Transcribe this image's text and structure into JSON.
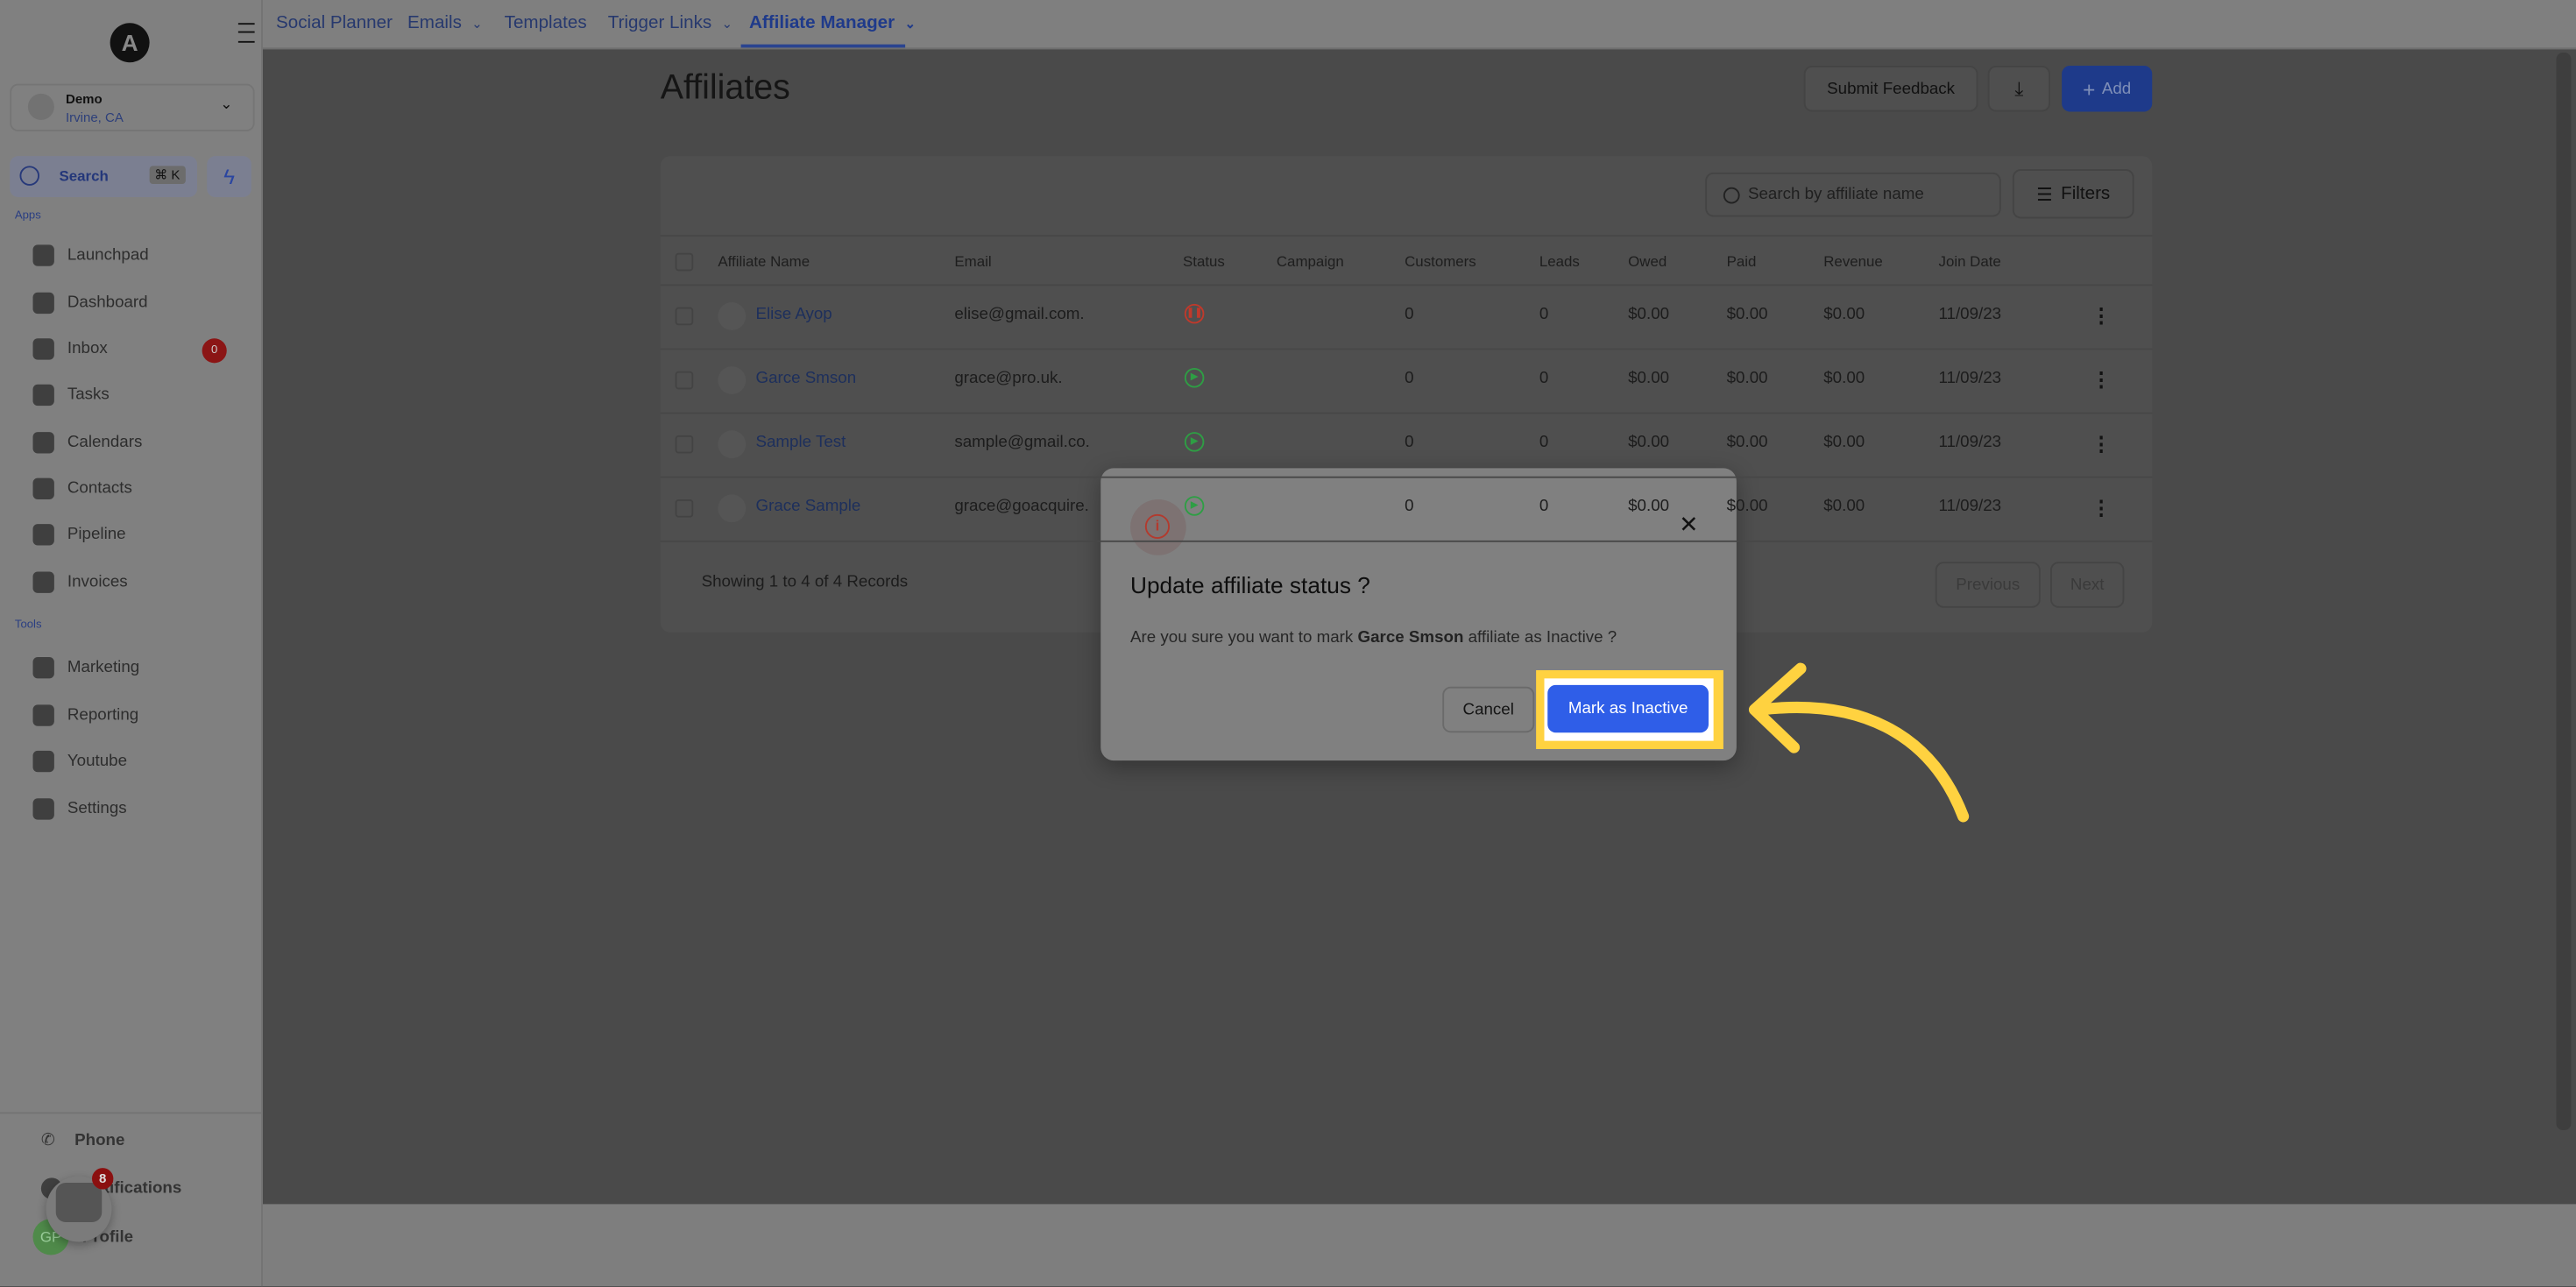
{
  "topnav": {
    "items": [
      {
        "label": "Social Planner",
        "dropdown": false
      },
      {
        "label": "Emails",
        "dropdown": true
      },
      {
        "label": "Templates",
        "dropdown": false
      },
      {
        "label": "Trigger Links",
        "dropdown": true
      },
      {
        "label": "Affiliate Manager",
        "dropdown": true,
        "active": true
      }
    ]
  },
  "sidebar": {
    "logo_letter": "A",
    "account": {
      "name": "Demo",
      "location": "Irvine, CA"
    },
    "search": {
      "label": "Search",
      "shortcut": "⌘ K"
    },
    "apps_label": "Apps",
    "apps": [
      {
        "label": "Launchpad",
        "icon": "rocket-icon"
      },
      {
        "label": "Dashboard",
        "icon": "dashboard-icon"
      },
      {
        "label": "Inbox",
        "icon": "inbox-icon",
        "badge": "0"
      },
      {
        "label": "Tasks",
        "icon": "tasks-icon"
      },
      {
        "label": "Calendars",
        "icon": "calendar-icon"
      },
      {
        "label": "Contacts",
        "icon": "contacts-icon"
      },
      {
        "label": "Pipeline",
        "icon": "pipeline-icon"
      },
      {
        "label": "Invoices",
        "icon": "invoice-icon"
      }
    ],
    "tools_label": "Tools",
    "tools": [
      {
        "label": "Marketing",
        "icon": "megaphone-icon"
      },
      {
        "label": "Reporting",
        "icon": "chart-icon"
      },
      {
        "label": "Youtube",
        "icon": "youtube-icon"
      },
      {
        "label": "Settings",
        "icon": "gear-icon"
      }
    ],
    "bottom": [
      {
        "label": "Phone"
      },
      {
        "label": "Notifications"
      },
      {
        "label": "Profile"
      }
    ],
    "chat_badge": "8",
    "profile_initials": "GP"
  },
  "page": {
    "title": "Affiliates",
    "submit_feedback": "Submit Feedback",
    "add_label": "Add"
  },
  "table": {
    "search_placeholder": "Search by affiliate name",
    "filters_label": "Filters",
    "columns": [
      "Affiliate Name",
      "Email",
      "Status",
      "Campaign",
      "Customers",
      "Leads",
      "Owed",
      "Paid",
      "Revenue",
      "Join Date"
    ],
    "rows": [
      {
        "name": "Elise Ayop",
        "email": "elise@gmail.com.",
        "status": "paused",
        "campaign": "",
        "customers": "0",
        "leads": "0",
        "owed": "$0.00",
        "paid": "$0.00",
        "revenue": "$0.00",
        "join": "11/09/23"
      },
      {
        "name": "Garce Smson",
        "email": "grace@pro.uk.",
        "status": "active",
        "campaign": "",
        "customers": "0",
        "leads": "0",
        "owed": "$0.00",
        "paid": "$0.00",
        "revenue": "$0.00",
        "join": "11/09/23"
      },
      {
        "name": "Sample Test",
        "email": "sample@gmail.co.",
        "status": "active",
        "campaign": "",
        "customers": "0",
        "leads": "0",
        "owed": "$0.00",
        "paid": "$0.00",
        "revenue": "$0.00",
        "join": "11/09/23"
      },
      {
        "name": "Grace Sample",
        "email": "grace@goacquire.",
        "status": "active",
        "campaign": "",
        "customers": "0",
        "leads": "0",
        "owed": "$0.00",
        "paid": "$0.00",
        "revenue": "$0.00",
        "join": "11/09/23"
      }
    ],
    "footer": "Showing 1 to 4 of 4 Records",
    "previous": "Previous",
    "next": "Next"
  },
  "modal": {
    "title": "Update affiliate status ?",
    "text_before": "Are you sure you want to mark ",
    "name": "Garce Smson",
    "text_after": " affiliate as Inactive ?",
    "cancel": "Cancel",
    "confirm": "Mark as Inactive"
  },
  "colors": {
    "primary": "#2f5ee8",
    "highlight": "#ffd240",
    "danger": "#c0392b",
    "success": "#2e9e44"
  }
}
